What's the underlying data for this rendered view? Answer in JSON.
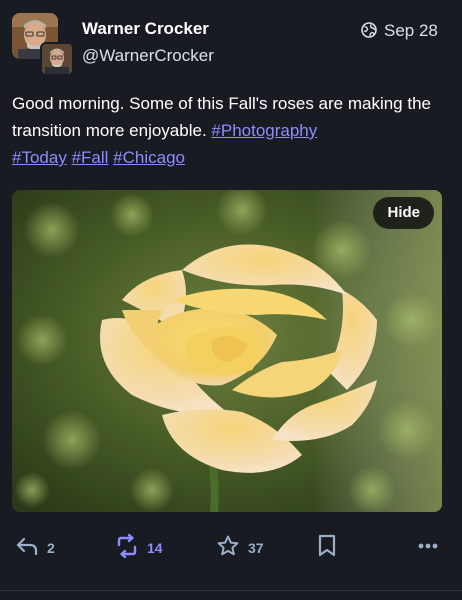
{
  "author": {
    "display_name": "Warner Crocker",
    "handle": "@WarnerCrocker"
  },
  "post": {
    "date": "Sep 28",
    "visibility_icon": "globe-icon",
    "text_plain": "Good morning. Some of this Fall's roses are making the transition more enjoyable.",
    "hashtags": [
      "#Photography",
      "#Today",
      "#Fall",
      "#Chicago"
    ]
  },
  "media": {
    "hide_label": "Hide",
    "subject": "yellow rose"
  },
  "actions": {
    "reply_icon": "reply-icon",
    "reply_count": "2",
    "boost_icon": "boost-icon",
    "boost_count": "14",
    "favourite_icon": "star-icon",
    "favourite_count": "37",
    "bookmark_icon": "bookmark-icon",
    "more_icon": "more-icon"
  },
  "colors": {
    "background": "#191b22",
    "hashtag": "#8c8dff",
    "boost_active": "#8c8dff",
    "action_default": "#9baec8"
  }
}
